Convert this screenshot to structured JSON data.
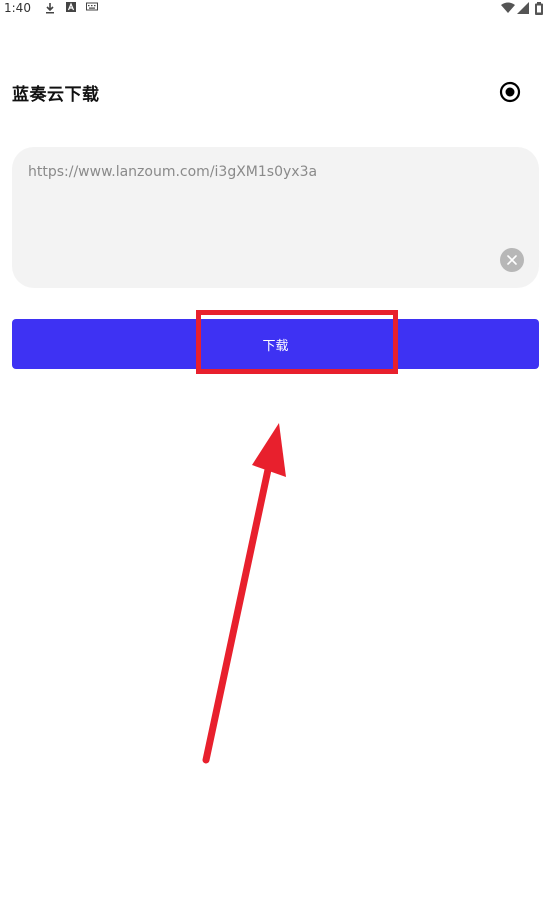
{
  "status_bar": {
    "time": "1:40",
    "left_icons": [
      "download-icon",
      "font-a-icon",
      "keyboard-icon"
    ],
    "right_icons": [
      "wifi-icon",
      "signal-icon",
      "battery-icon"
    ]
  },
  "header": {
    "title": "蓝奏云下载",
    "action_icon": "record-icon"
  },
  "url_input": {
    "value": "https://www.lanzoum.com/i3gXM1s0yx3a",
    "clear_icon": "clear-icon"
  },
  "download_button": {
    "label": "下载",
    "color": "#3e32f3"
  },
  "annotation": {
    "highlight_color": "#e8202d",
    "arrow_color": "#e8202d"
  }
}
